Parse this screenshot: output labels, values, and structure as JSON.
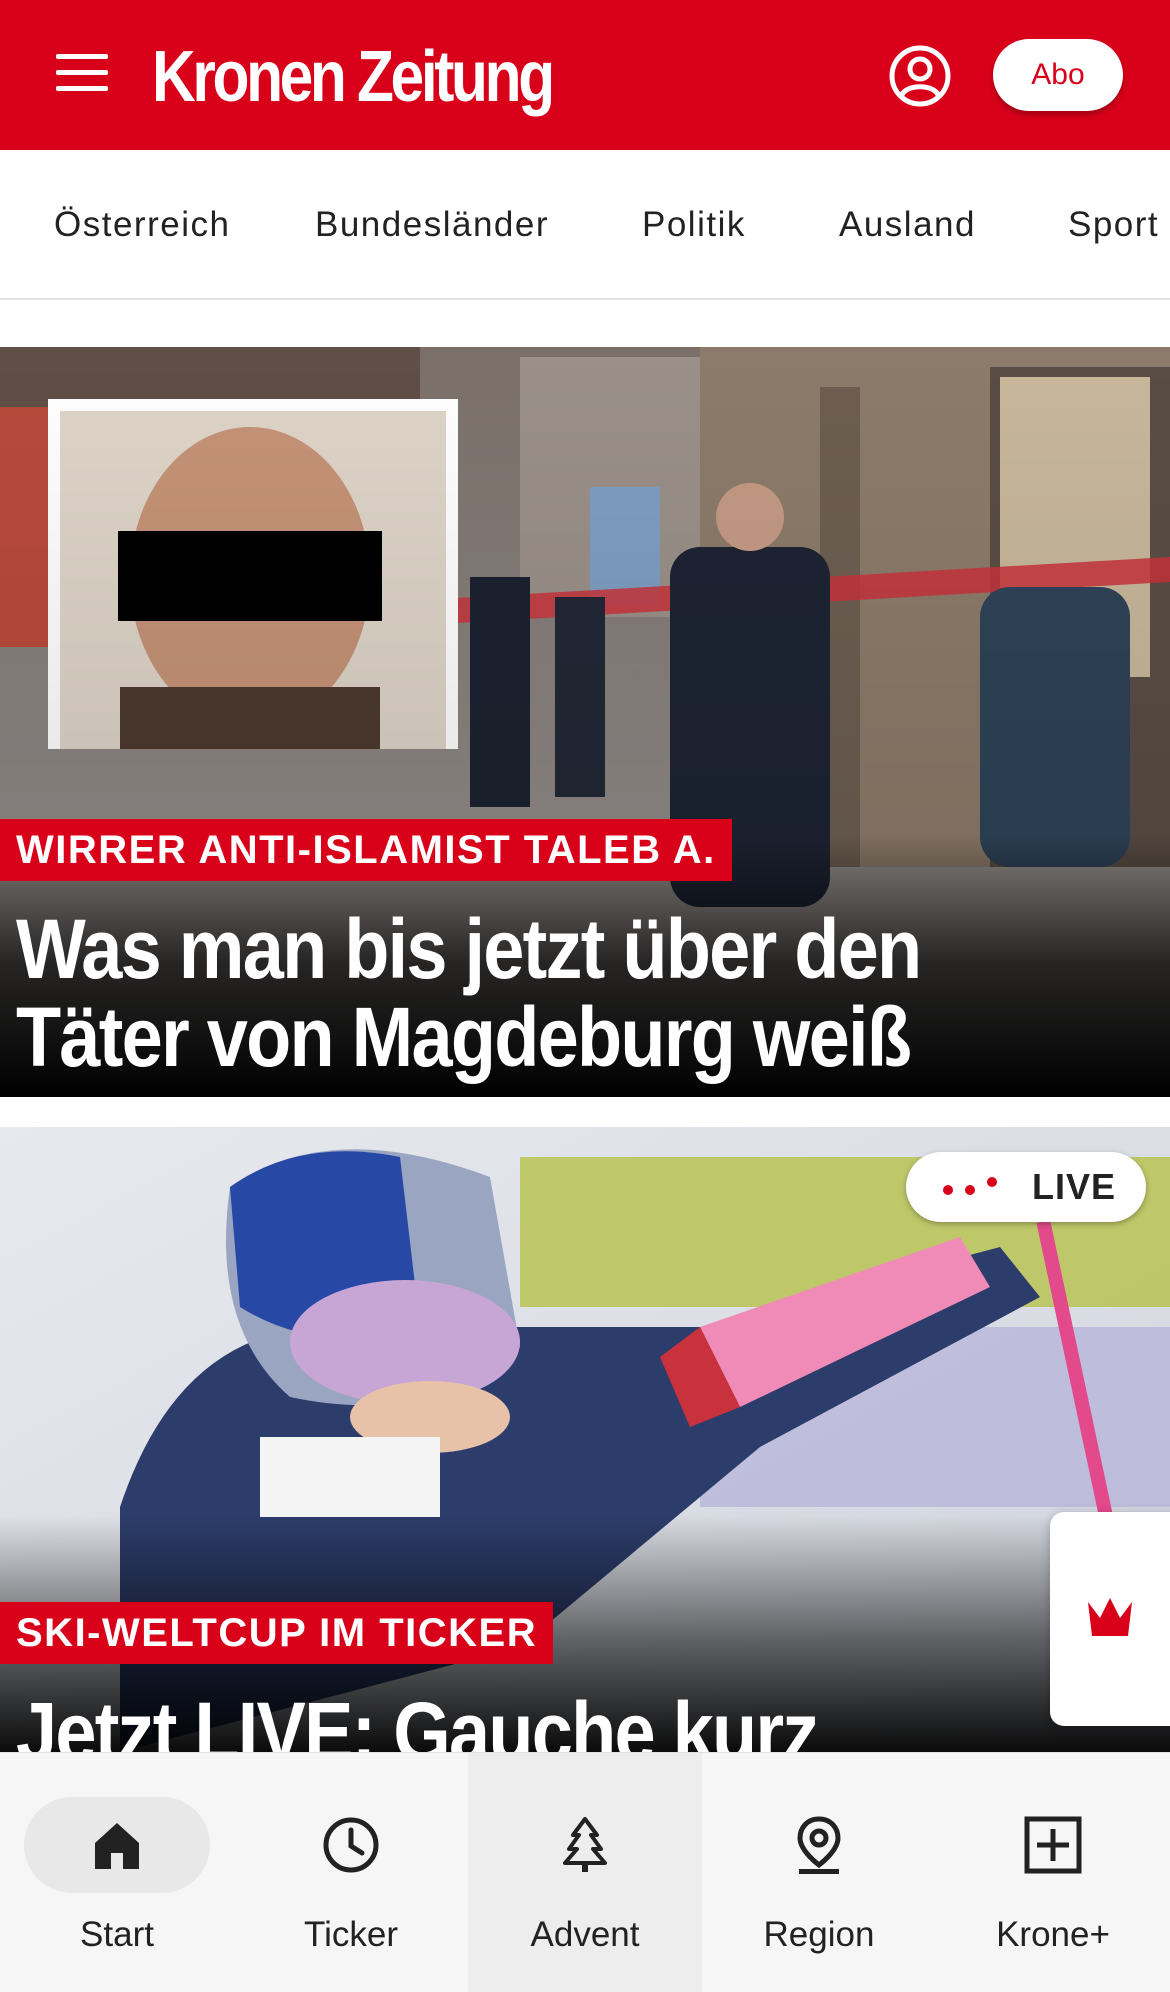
{
  "header": {
    "logo": "Kronen Zeitung",
    "abo_label": "Abo",
    "brand_color": "#d9001a"
  },
  "nav": {
    "items": [
      "Österreich",
      "Bundesländer",
      "Politik",
      "Ausland",
      "Sport"
    ]
  },
  "articles": [
    {
      "kicker": "WIRRER ANTI-ISLAMIST TALEB A.",
      "headline_line1": "Was man bis jetzt über den",
      "headline_line2": "Täter von Magdeburg weiß"
    },
    {
      "kicker": "SKI-WELTCUP IM TICKER",
      "headline_line1": "Jetzt LIVE: Gauche kurz",
      "live_label": "LIVE"
    }
  ],
  "tabbar": {
    "tabs": [
      {
        "label": "Start",
        "icon": "home-icon"
      },
      {
        "label": "Ticker",
        "icon": "clock-icon"
      },
      {
        "label": "Advent",
        "icon": "tree-icon"
      },
      {
        "label": "Region",
        "icon": "location-pin-icon"
      },
      {
        "label": "Krone+",
        "icon": "plus-box-icon"
      }
    ]
  }
}
